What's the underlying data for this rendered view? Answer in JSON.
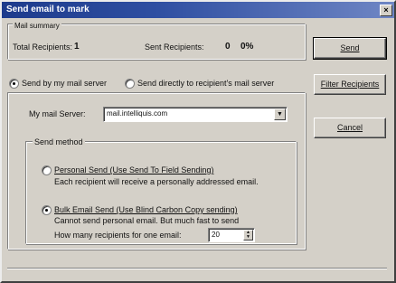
{
  "window": {
    "title": "Send email to mark",
    "close_glyph": "×"
  },
  "mail_summary": {
    "legend": "Mail summary",
    "total_label": "Total Recipients:",
    "total_value": "1",
    "sent_label": "Sent Recipients:",
    "sent_value": "0",
    "sent_pct": "0%"
  },
  "server_options": {
    "send_by_mail_server": "Send by my mail server",
    "send_directly": "Send directly to recipient's mail server",
    "selected": "send_by_mail_server"
  },
  "mail_server": {
    "label": "My mail Server:",
    "value": "mail.intelliquis.com"
  },
  "send_method": {
    "legend": "Send method",
    "personal_label": "Personal Send (Use Send To Field Sending)",
    "personal_desc": "Each recipient will receive a personally addressed email.",
    "bulk_label": "Bulk Email Send (Use Blind Carbon Copy sending)",
    "bulk_desc": "Cannot send personal email. But much fast to send",
    "recipients_label": "How many recipients for one email:",
    "recipients_value": "20",
    "selected": "bulk"
  },
  "buttons": {
    "send": "Send",
    "filter": "Filter Recipients",
    "cancel": "Cancel"
  }
}
